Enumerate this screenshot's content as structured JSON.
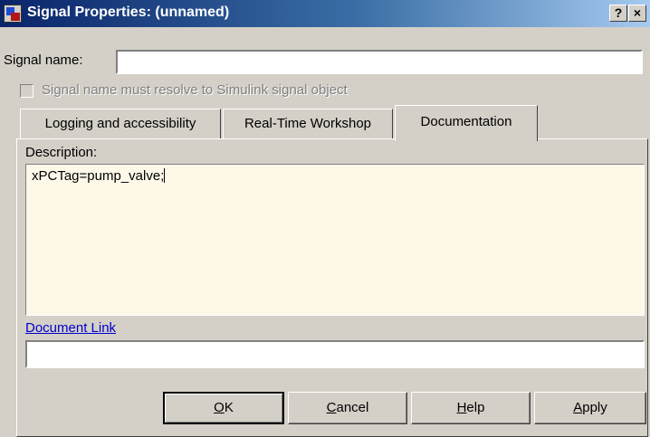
{
  "window": {
    "title": "Signal Properties: (unnamed)",
    "help_glyph": "?",
    "close_glyph": "×"
  },
  "signal_name": {
    "label": "Signal name:",
    "value": ""
  },
  "resolve_checkbox": {
    "label": "Signal name must resolve to Simulink signal object",
    "checked": false,
    "enabled": false
  },
  "tabs": [
    {
      "label": "Logging and accessibility",
      "active": false
    },
    {
      "label": "Real-Time Workshop",
      "active": false
    },
    {
      "label": "Documentation",
      "active": true
    }
  ],
  "documentation": {
    "description_label": "Description:",
    "description_value": "xPCTag=pump_valve;",
    "link_label": "Document Link",
    "link_value": ""
  },
  "buttons": {
    "ok": {
      "mnemonic": "O",
      "rest": "K"
    },
    "cancel": {
      "mnemonic": "C",
      "rest": "ancel"
    },
    "help": {
      "mnemonic": "H",
      "rest": "elp"
    },
    "apply": {
      "mnemonic": "A",
      "rest": "pply"
    }
  },
  "colors": {
    "title_bar_start": "#0a246a",
    "title_bar_end": "#a6caf0",
    "dialog_face": "#d4d0c8",
    "description_background": "#fef8e9",
    "link": "#0000cc"
  },
  "icons": {
    "app": "simulink-app-icon",
    "help": "help-icon",
    "close": "close-icon",
    "checkbox": "checkbox-icon"
  }
}
